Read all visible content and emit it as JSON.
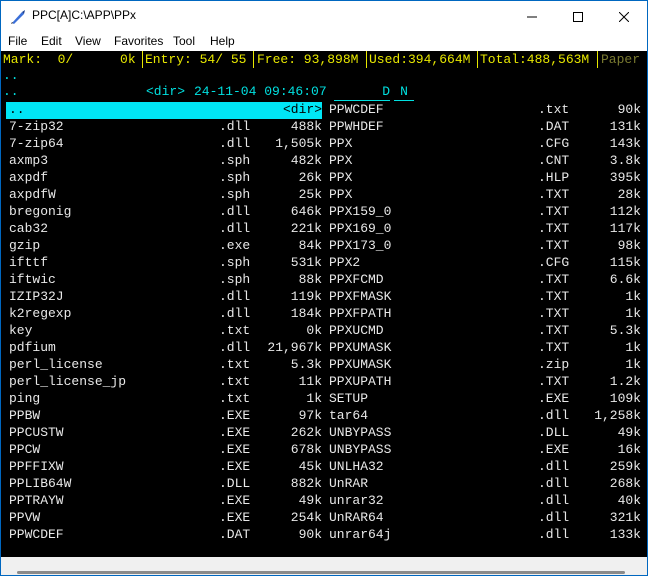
{
  "window": {
    "title": "PPC[A]C:\\APP\\PPx"
  },
  "menu": [
    "File",
    "Edit",
    "View",
    "Favorites",
    "Tool",
    "Help"
  ],
  "info": {
    "mark": "Mark:  0/      0k",
    "entry": "Entry: 54/ 55",
    "free": "Free: 93,898M",
    "used": "Used:394,664M",
    "total": "Total:488,563M",
    "paper": "Paper"
  },
  "pathbar": {
    "line1": "..",
    "line2_prefix": "..",
    "dir_tag": "<dir>",
    "datetime": "24-11-04 09:46:07",
    "attr": "D",
    "n": "N"
  },
  "colors": {
    "cyan": "#00e0e0",
    "yellow": "#e8e800",
    "cursor": "#00e6f6",
    "text": "#e8e8e8"
  },
  "left_files": [
    {
      "name": "..",
      "ext": "",
      "size": "<dir>"
    },
    {
      "name": "7-zip32",
      "ext": ".dll",
      "size": "488k"
    },
    {
      "name": "7-zip64",
      "ext": ".dll",
      "size": "1,505k"
    },
    {
      "name": "axmp3",
      "ext": ".sph",
      "size": "482k"
    },
    {
      "name": "axpdf",
      "ext": ".sph",
      "size": "26k"
    },
    {
      "name": "axpdfW",
      "ext": ".sph",
      "size": "25k"
    },
    {
      "name": "bregonig",
      "ext": ".dll",
      "size": "646k"
    },
    {
      "name": "cab32",
      "ext": ".dll",
      "size": "221k"
    },
    {
      "name": "gzip",
      "ext": ".exe",
      "size": "84k"
    },
    {
      "name": "ifttf",
      "ext": ".sph",
      "size": "531k"
    },
    {
      "name": "iftwic",
      "ext": ".sph",
      "size": "88k"
    },
    {
      "name": "IZIP32J",
      "ext": ".dll",
      "size": "119k"
    },
    {
      "name": "k2regexp",
      "ext": ".dll",
      "size": "184k"
    },
    {
      "name": "key",
      "ext": ".txt",
      "size": "0k"
    },
    {
      "name": "pdfium",
      "ext": ".dll",
      "size": "21,967k"
    },
    {
      "name": "perl_license",
      "ext": ".txt",
      "size": "5.3k"
    },
    {
      "name": "perl_license_jp",
      "ext": ".txt",
      "size": "11k"
    },
    {
      "name": "ping",
      "ext": ".txt",
      "size": "1k"
    },
    {
      "name": "PPBW",
      "ext": ".EXE",
      "size": "97k"
    },
    {
      "name": "PPCUSTW",
      "ext": ".EXE",
      "size": "262k"
    },
    {
      "name": "PPCW",
      "ext": ".EXE",
      "size": "678k"
    },
    {
      "name": "PPFFIXW",
      "ext": ".EXE",
      "size": "45k"
    },
    {
      "name": "PPLIB64W",
      "ext": ".DLL",
      "size": "882k"
    },
    {
      "name": "PPTRAYW",
      "ext": ".EXE",
      "size": "49k"
    },
    {
      "name": "PPVW",
      "ext": ".EXE",
      "size": "254k"
    },
    {
      "name": "PPWCDEF",
      "ext": ".DAT",
      "size": "90k"
    }
  ],
  "right_files": [
    {
      "name": "PPWCDEF",
      "ext": ".txt",
      "size": "90k"
    },
    {
      "name": "PPWHDEF",
      "ext": ".DAT",
      "size": "131k"
    },
    {
      "name": "PPX",
      "ext": ".CFG",
      "size": "143k"
    },
    {
      "name": "PPX",
      "ext": ".CNT",
      "size": "3.8k"
    },
    {
      "name": "PPX",
      "ext": ".HLP",
      "size": "395k"
    },
    {
      "name": "PPX",
      "ext": ".TXT",
      "size": "28k"
    },
    {
      "name": "PPX159_0",
      "ext": ".TXT",
      "size": "112k"
    },
    {
      "name": "PPX169_0",
      "ext": ".TXT",
      "size": "117k"
    },
    {
      "name": "PPX173_0",
      "ext": ".TXT",
      "size": "98k"
    },
    {
      "name": "PPX2",
      "ext": ".CFG",
      "size": "115k"
    },
    {
      "name": "PPXFCMD",
      "ext": ".TXT",
      "size": "6.6k"
    },
    {
      "name": "PPXFMASK",
      "ext": ".TXT",
      "size": "1k"
    },
    {
      "name": "PPXFPATH",
      "ext": ".TXT",
      "size": "1k"
    },
    {
      "name": "PPXUCMD",
      "ext": ".TXT",
      "size": "5.3k"
    },
    {
      "name": "PPXUMASK",
      "ext": ".TXT",
      "size": "1k"
    },
    {
      "name": "PPXUMASK",
      "ext": ".zip",
      "size": "1k"
    },
    {
      "name": "PPXUPATH",
      "ext": ".TXT",
      "size": "1.2k"
    },
    {
      "name": "SETUP",
      "ext": ".EXE",
      "size": "109k"
    },
    {
      "name": "tar64",
      "ext": ".dll",
      "size": "1,258k"
    },
    {
      "name": "UNBYPASS",
      "ext": ".DLL",
      "size": "49k"
    },
    {
      "name": "UNBYPASS",
      "ext": ".EXE",
      "size": "16k"
    },
    {
      "name": "UNLHA32",
      "ext": ".dll",
      "size": "259k"
    },
    {
      "name": "UnRAR",
      "ext": ".dll",
      "size": "268k"
    },
    {
      "name": "unrar32",
      "ext": ".dll",
      "size": "40k"
    },
    {
      "name": "UnRAR64",
      "ext": ".dll",
      "size": "321k"
    },
    {
      "name": "unrar64j",
      "ext": ".dll",
      "size": "133k"
    }
  ]
}
